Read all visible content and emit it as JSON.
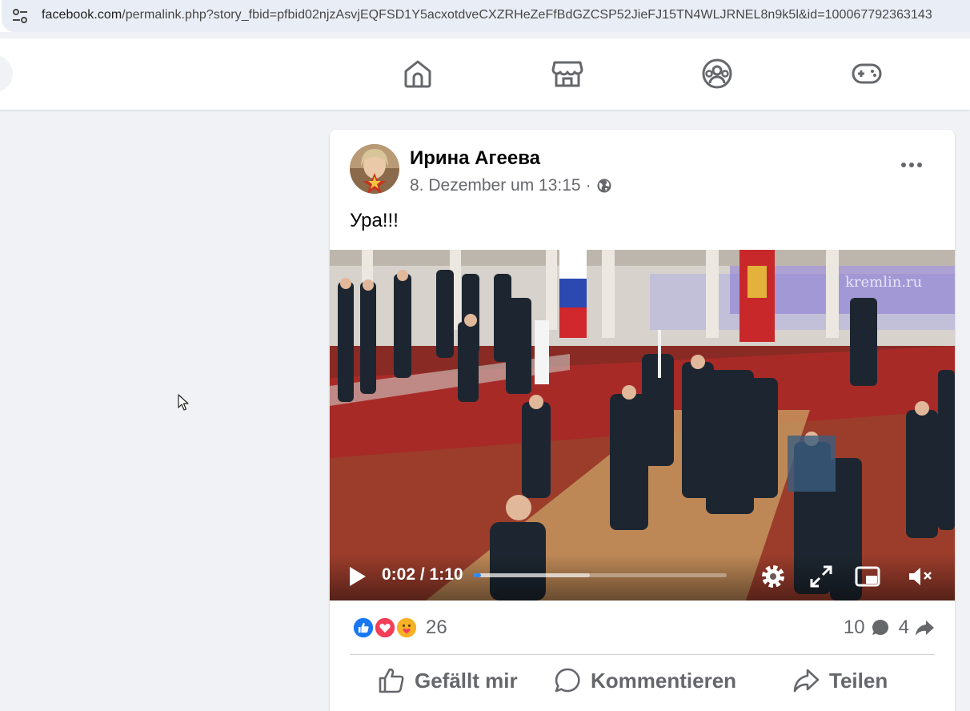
{
  "browser": {
    "url_host": "facebook.com",
    "url_path": "/permalink.php?story_fbid=pfbid02njzAsvjEQFSD1Y5acxotdveCXZRHeZeFfBdGZCSP52JieFJ15TN4WLJRNEL8n9k5l&id=100067792363143"
  },
  "nav": {
    "icons": [
      "home-icon",
      "marketplace-icon",
      "groups-icon",
      "gaming-icon"
    ]
  },
  "post": {
    "author": "Ирина Агеева",
    "timestamp": "8. Dezember um 13:15",
    "separator": "·",
    "privacy_icon": "globe-icon",
    "text": "Ура!!!",
    "video": {
      "watermark": "kremlin.ru",
      "time": "0:02 / 1:10",
      "progress": 0.03,
      "buffered": 0.46
    },
    "reactions": {
      "types": [
        "like",
        "love",
        "care"
      ],
      "count": "26"
    },
    "comments_count": "10",
    "shares_count": "4",
    "actions": {
      "like": "Gefällt mir",
      "comment": "Kommentieren",
      "share": "Teilen"
    }
  },
  "colors": {
    "like_blue": "#1877f2",
    "love_red": "#f33e58",
    "care_yellow": "#f7b125",
    "secondary_text": "#65676b",
    "page_bg": "#f0f2f5"
  }
}
